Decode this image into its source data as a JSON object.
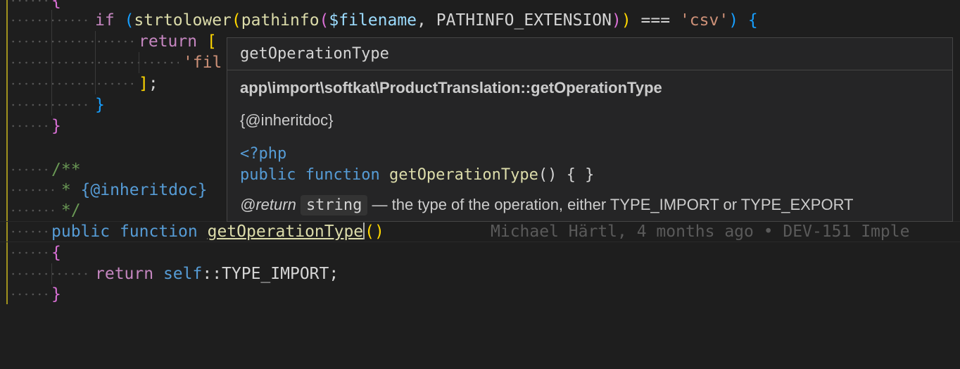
{
  "code": {
    "l0": {
      "text": "{"
    },
    "l1": {
      "if": "if",
      "open": "(",
      "strtolower": "strtolower",
      "p1": "(",
      "pathinfo": "pathinfo",
      "p2": "(",
      "var": "$filename",
      "comma": ", ",
      "const": "PATHINFO_EXTENSION",
      "c2": ")",
      "c1": ")",
      "op": " === ",
      "str": "'csv'",
      "c0": ")",
      "brace": "{"
    },
    "l2": {
      "return": "return",
      "bracket": "["
    },
    "l3": {
      "str": "'fil"
    },
    "l4": {
      "close": "]",
      "semi": ";"
    },
    "l5": {
      "brace": "}"
    },
    "l6": {
      "brace": "}"
    },
    "l8": {
      "text": "/**"
    },
    "l9": {
      "star": " * ",
      "tag": "{@inheritdoc}"
    },
    "l10": {
      "text": " */"
    },
    "l11": {
      "public": "public",
      "function": "function",
      "name": "getOperationType",
      "parens": "()",
      "blame": "Michael Härtl, 4 months ago • DEV-151 Imple"
    },
    "l12": {
      "brace": "{"
    },
    "l13": {
      "return": "return",
      "self": "self",
      "rest": "::TYPE_IMPORT;"
    },
    "l14": {
      "brace": "}"
    }
  },
  "hover": {
    "signature": "getOperationType",
    "fqn": "app\\import\\softkat\\ProductTranslation::getOperationType",
    "doc": "{@inheritdoc}",
    "php_open": "<?php",
    "php_public": "public",
    "php_function": "function",
    "php_name": "getOperationType",
    "php_rest": "() { }",
    "return_tag": "@return",
    "return_type": "string",
    "return_desc": " — the type of the operation, either TYPE_IMPORT or TYPE_EXPORT"
  },
  "colors": {
    "background": "#1e1e1e",
    "hover_bg": "#252526",
    "keyword": "#c586c0",
    "storage": "#569cd6",
    "function": "#dcdcaa",
    "string": "#ce9178",
    "comment": "#6a9955"
  }
}
